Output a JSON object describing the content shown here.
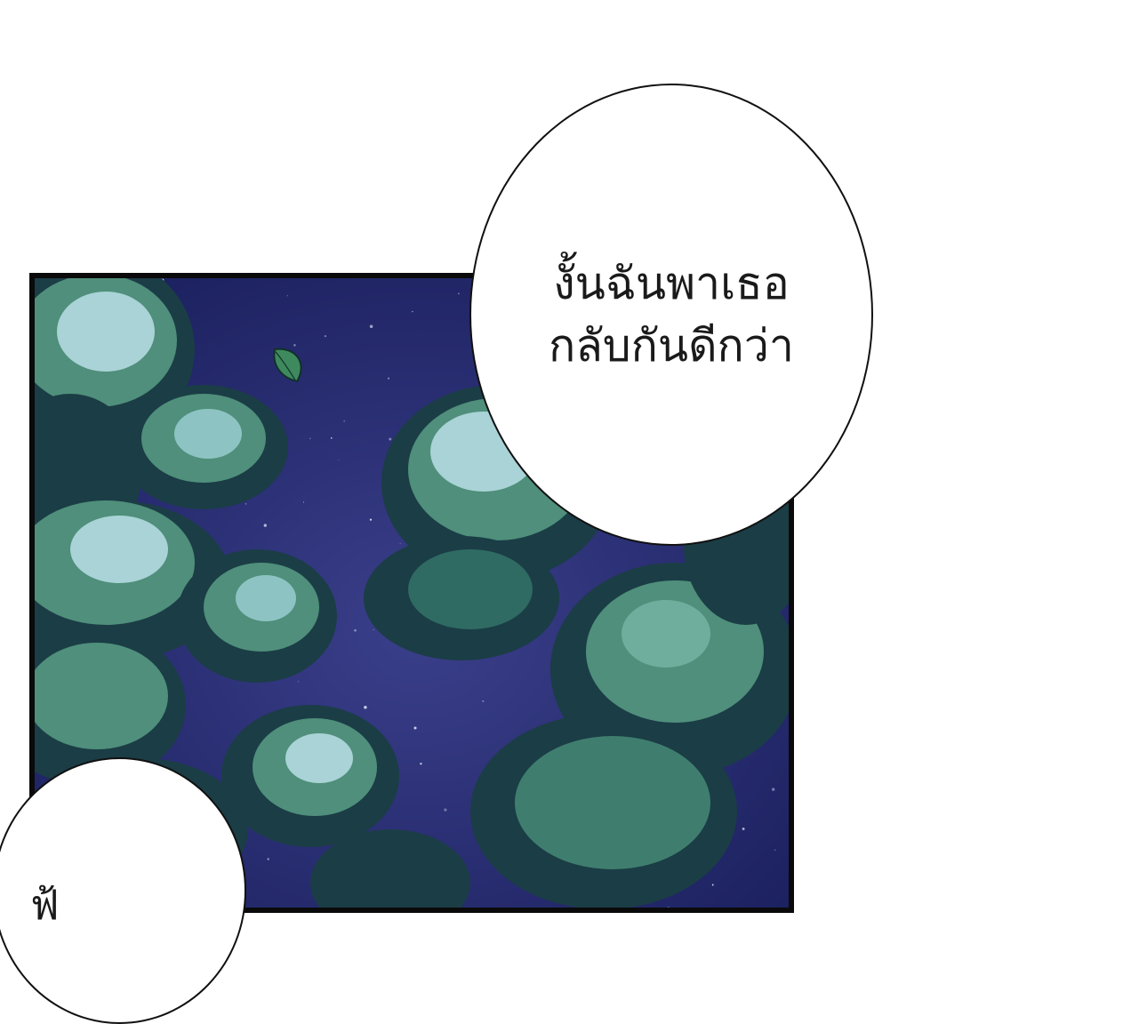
{
  "speech": {
    "main_lines": [
      "งั้นฉันพาเธอ",
      "กลับกันดีกว่า"
    ],
    "partial_line": "ฟ้"
  },
  "colors": {
    "sky": "#232a6e",
    "foliage_light": "#a9d3d6",
    "foliage_mid": "#4f8f7b",
    "foliage_dark": "#1b3d46",
    "leaf": "#3e8a5e",
    "bubble": "#ffffff",
    "ink": "#1a1a1a"
  },
  "icons": [
    "falling-leaf-icon",
    "star-field"
  ]
}
